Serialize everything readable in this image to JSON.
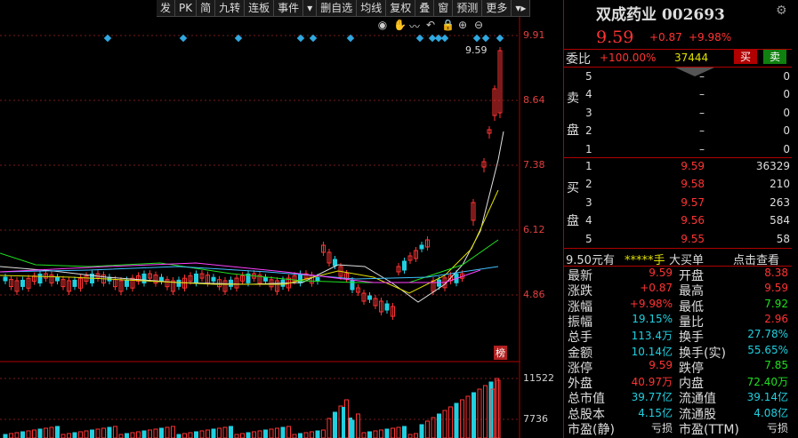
{
  "toolbar": [
    "发",
    "PK",
    "简",
    "九转",
    "连板",
    "事件",
    "▾",
    "删自选",
    "均线",
    "复权",
    "叠",
    "窗",
    "预测",
    "更多",
    "▾▸"
  ],
  "chart_tools": [
    "eye-icon",
    "hand-icon",
    "wave-icon",
    "undo-icon",
    "lock-icon",
    "zoom-in-icon",
    "zoom-out-icon"
  ],
  "chart_tool_glyphs": [
    "◉",
    "✋",
    "〰",
    "↶",
    "🔒",
    "⊕",
    "⊖"
  ],
  "price_axis": [
    "9.91",
    "8.64",
    "7.38",
    "6.12",
    "4.86"
  ],
  "volume_axis": [
    "11522",
    "7736"
  ],
  "high_label": "9.59",
  "tag": "榜",
  "colors": {
    "up": "#ff3333",
    "down": "#20d0e0",
    "ma1": "#e0e0e0",
    "ma2": "#e0e000",
    "ma3": "#20e020",
    "ma4": "#40c0ff",
    "ma5": "#ff40ff"
  },
  "quote": {
    "title": "双成药业 002693",
    "price": "9.59",
    "change": "+0.87",
    "change_pct": "+9.98%",
    "weibi_label": "委比",
    "weibi_value": "+100.00%",
    "weibi_vol": "37444",
    "buy_btn": "买",
    "sell_btn": "卖",
    "sell_label": [
      "卖",
      "盘"
    ],
    "buy_label": [
      "买",
      "盘"
    ],
    "asks": [
      {
        "lvl": "5",
        "price": "–",
        "vol": "0"
      },
      {
        "lvl": "4",
        "price": "–",
        "vol": "0"
      },
      {
        "lvl": "3",
        "price": "–",
        "vol": "0"
      },
      {
        "lvl": "2",
        "price": "–",
        "vol": "0"
      },
      {
        "lvl": "1",
        "price": "–",
        "vol": "0"
      }
    ],
    "bids": [
      {
        "lvl": "1",
        "price": "9.59",
        "vol": "36329"
      },
      {
        "lvl": "2",
        "price": "9.58",
        "vol": "210"
      },
      {
        "lvl": "3",
        "price": "9.57",
        "vol": "263"
      },
      {
        "lvl": "4",
        "price": "9.56",
        "vol": "584"
      },
      {
        "lvl": "5",
        "price": "9.55",
        "vol": "58"
      }
    ],
    "info_left": "9.50元有",
    "info_mask": "*****手",
    "info_mid": "大买单",
    "info_right": "点击查看",
    "stats": [
      {
        "k1": "最新",
        "v1": "9.59",
        "c1": "red",
        "k2": "开盘",
        "v2": "8.38",
        "c2": "red"
      },
      {
        "k1": "涨跌",
        "v1": "+0.87",
        "c1": "red",
        "k2": "最高",
        "v2": "9.59",
        "c2": "red"
      },
      {
        "k1": "涨幅",
        "v1": "+9.98%",
        "c1": "red",
        "k2": "最低",
        "v2": "7.92",
        "c2": "green"
      },
      {
        "k1": "振幅",
        "v1": "19.15%",
        "c1": "cyan",
        "k2": "量比",
        "v2": "2.96",
        "c2": "red"
      },
      {
        "k1": "总手",
        "v1": "113.4万",
        "c1": "cyan",
        "k2": "换手",
        "v2": "27.78%",
        "c2": "cyan"
      },
      {
        "k1": "金额",
        "v1": "10.14亿",
        "c1": "cyan",
        "k2": "换手(实)",
        "v2": "55.65%",
        "c2": "cyan"
      },
      {
        "k1": "涨停",
        "v1": "9.59",
        "c1": "red",
        "k2": "跌停",
        "v2": "7.85",
        "c2": "green"
      },
      {
        "k1": "外盘",
        "v1": "40.97万",
        "c1": "red",
        "k2": "内盘",
        "v2": "72.40万",
        "c2": "green"
      },
      {
        "k1": "总市值",
        "v1": "39.77亿",
        "c1": "cyan",
        "k2": "流通值",
        "v2": "39.14亿",
        "c2": "cyan"
      },
      {
        "k1": "总股本",
        "v1": "4.15亿",
        "c1": "cyan",
        "k2": "流通股",
        "v2": "4.08亿",
        "c2": "cyan"
      },
      {
        "k1": "市盈(静)",
        "v1": "亏损",
        "c1": "white",
        "k2": "市盈(TTM)",
        "v2": "亏损",
        "c2": "white"
      }
    ]
  }
}
